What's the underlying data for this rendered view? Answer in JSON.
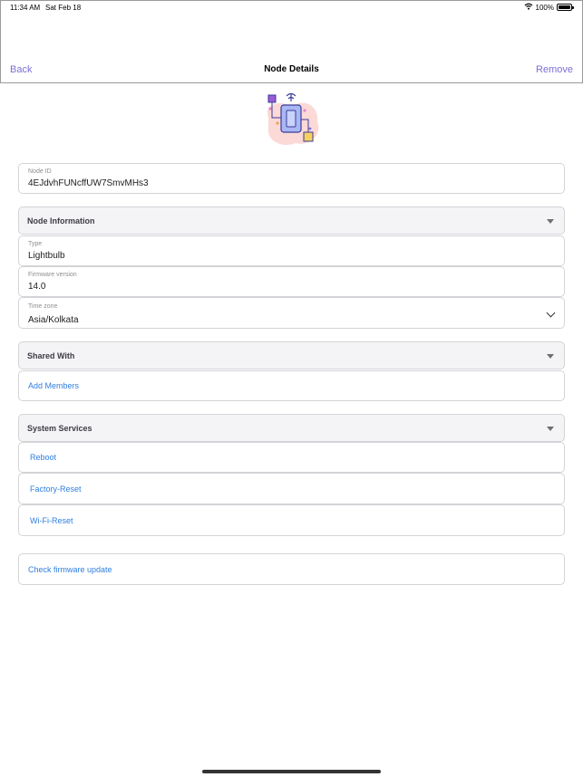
{
  "status_bar": {
    "time": "11:34 AM",
    "date": "Sat Feb 18",
    "battery": "100%",
    "battery_level": 1.0
  },
  "nav": {
    "back_label": "Back",
    "title": "Node Details",
    "remove_label": "Remove"
  },
  "node_id": {
    "label": "Node ID",
    "value": "4EJdvhFUNcffUW7SmvMHs3"
  },
  "node_information": {
    "header": "Node Information",
    "type": {
      "label": "Type",
      "value": "Lightbulb"
    },
    "firmware": {
      "label": "Firmware version",
      "value": "14.0"
    },
    "timezone": {
      "label": "Time zone",
      "value": "Asia/Kolkata"
    }
  },
  "shared_with": {
    "header": "Shared With",
    "add_members_label": "Add Members"
  },
  "system_services": {
    "header": "System Services",
    "items": [
      "Reboot",
      "Factory-Reset",
      "Wi-Fi-Reset"
    ]
  },
  "firmware_update": {
    "label": "Check firmware update"
  },
  "colors": {
    "accent": "#7b6fd6",
    "link": "#2f7fe0",
    "section_bg": "#f4f4f7",
    "border": "#d4d4d8"
  }
}
